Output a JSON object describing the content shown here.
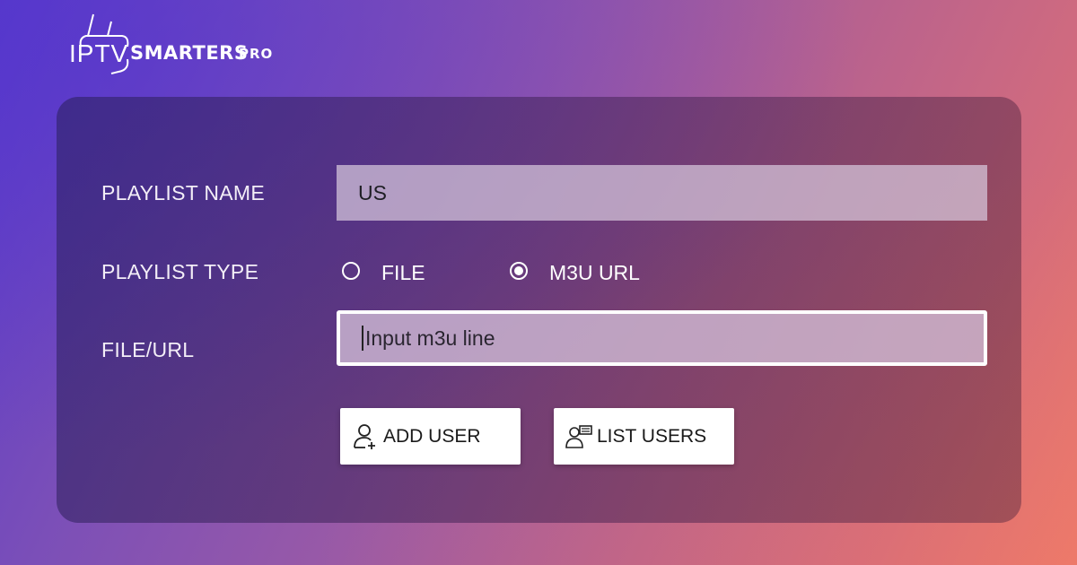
{
  "logo": {
    "iptv": "IPTV",
    "smarters": "SMARTERS",
    "pro": "PRO"
  },
  "form": {
    "playlist_name_label": "PLAYLIST NAME",
    "playlist_name_value": "US",
    "playlist_type_label": "PLAYLIST TYPE",
    "type_options": [
      {
        "label": "FILE",
        "selected": false
      },
      {
        "label": "M3U URL",
        "selected": true
      }
    ],
    "file_url_label": "FILE/URL",
    "file_url_placeholder": "Input m3u line"
  },
  "buttons": {
    "add_user": "ADD USER",
    "list_users": "LIST USERS"
  },
  "icons": {
    "logo": "tv-antenna-icon",
    "add_user": "add-user-icon",
    "list_users": "list-users-icon"
  }
}
